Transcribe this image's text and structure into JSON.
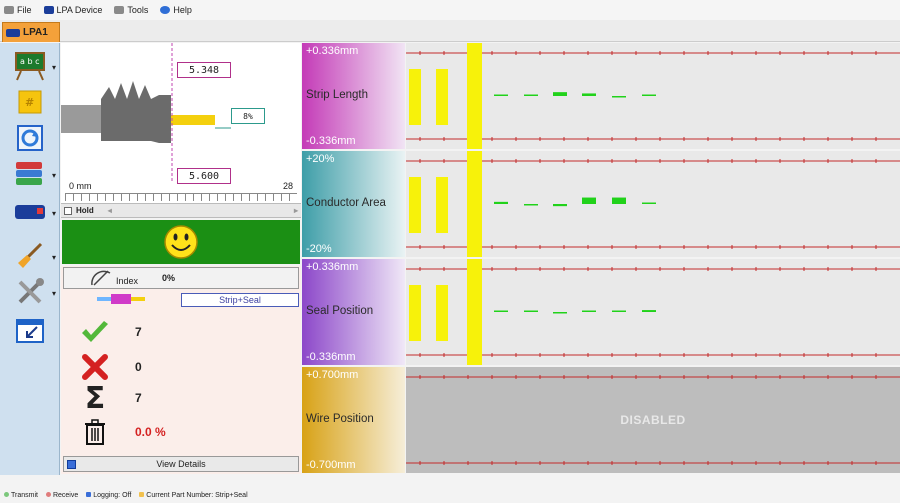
{
  "menu": {
    "file": "File",
    "device": "LPA Device",
    "tools": "Tools",
    "help": "Help"
  },
  "tab": {
    "label": "LPA1"
  },
  "diagram": {
    "strip_length_value": "5.348",
    "conductor_pct": "8%",
    "seal_value": "5.600",
    "scale_start": "0 mm",
    "scale_end": "28"
  },
  "hold": {
    "label": "Hold"
  },
  "index": {
    "label": "Index",
    "value": "0%"
  },
  "part_button": {
    "label": "Strip+Seal"
  },
  "stats": {
    "good": "7",
    "bad": "0",
    "total": "7",
    "scrap": "0.0 %"
  },
  "details_button": {
    "label": "View Details"
  },
  "charts": [
    {
      "name": "Strip Length",
      "top": "+0.336mm",
      "bottom": "-0.336mm",
      "grad": [
        "#c43bb7",
        "#f1e4f4"
      ]
    },
    {
      "name": "Conductor Area",
      "top": "+20%",
      "bottom": "-20%",
      "grad": [
        "#3e9ea8",
        "#eaf3f4"
      ]
    },
    {
      "name": "Seal Position",
      "top": "+0.336mm",
      "bottom": "-0.336mm",
      "grad": [
        "#8c47c9",
        "#f0e8f7"
      ]
    },
    {
      "name": "Wire Position",
      "top": "+0.700mm",
      "bottom": "-0.700mm",
      "grad": [
        "#d8a216",
        "#f6eed9"
      ]
    }
  ],
  "disabled_text": "DISABLED",
  "chart_data": [
    {
      "type": "bar",
      "series": [
        {
          "values": [
            0,
            0,
            0.03,
            0.02,
            -0.01,
            0.01
          ]
        }
      ]
    },
    {
      "type": "bar",
      "series": [
        {
          "values": [
            0.01,
            -0.002,
            -0.01,
            0.03,
            0.03,
            0
          ]
        }
      ]
    },
    {
      "type": "bar",
      "series": [
        {
          "values": [
            0,
            0,
            -0.002,
            0,
            0.01,
            0.015
          ]
        }
      ]
    }
  ],
  "footer": {
    "transmit": "Transmit",
    "receive": "Receive",
    "logging": "Logging: Off",
    "part": "Current Part Number: Strip+Seal"
  },
  "colors": {
    "ok_green": "#1b8f14",
    "bar_green": "#21d21a",
    "bar_yellow": "#f7f20a",
    "limit_red": "#c32a2a"
  }
}
